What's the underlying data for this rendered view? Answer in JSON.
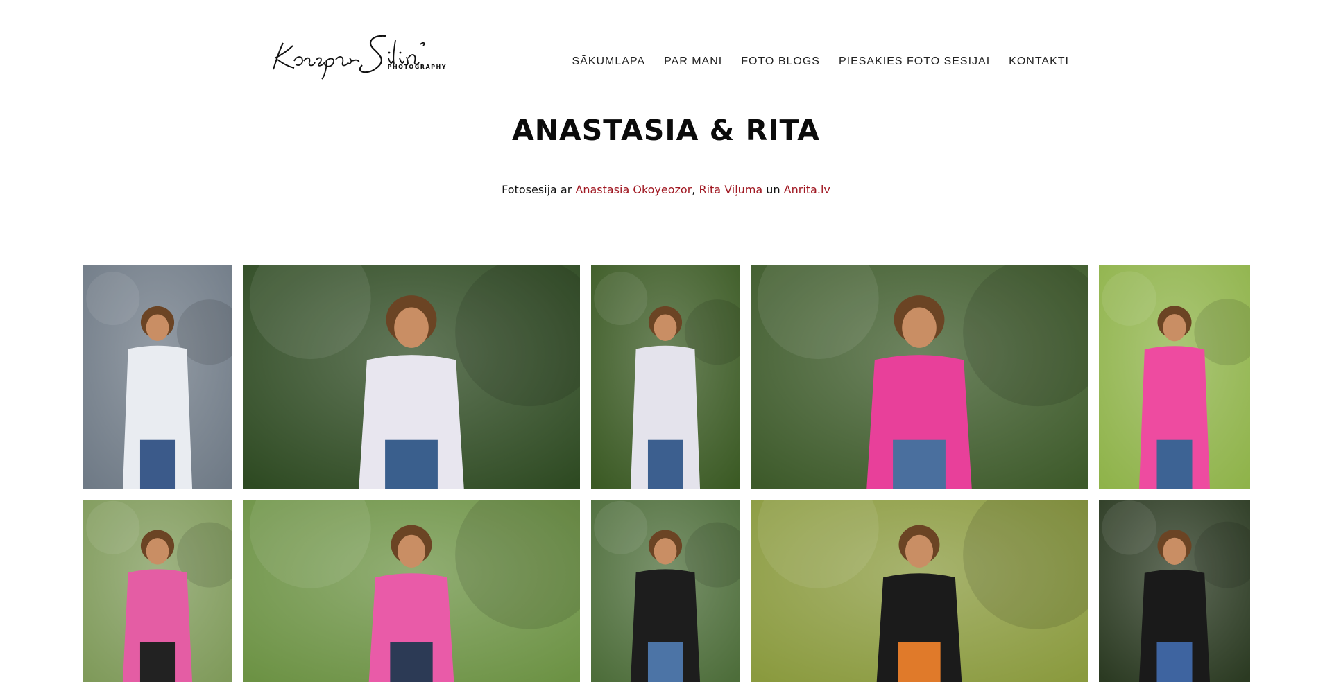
{
  "header": {
    "logo_name": "Kaspars Siliņš",
    "logo_tagline": "PHOTOGRAPHY",
    "nav": [
      {
        "label": "SĀKUMLAPA"
      },
      {
        "label": "PAR MANI"
      },
      {
        "label": "FOTO BLOGS"
      },
      {
        "label": "PIESAKIES FOTO SESIJAI"
      },
      {
        "label": "KONTAKTI"
      }
    ]
  },
  "post": {
    "title": "ANASTASIA & RITA",
    "intro_prefix": "Fotosesija ar ",
    "link1": "Anastasia Okoyeozor",
    "sep1": ", ",
    "link2": "Rita Viļuma",
    "sep2": " un ",
    "link3": "Anrita.lv"
  },
  "colors": {
    "accent_link": "#a01822",
    "text": "#111111",
    "divider": "#e6e6e6"
  },
  "gallery": [
    {
      "name": "photo-white-poncho-stone-wall",
      "bg": "#6f7a86",
      "fg": "#e9ecf1",
      "accent": "#3b5a8a"
    },
    {
      "name": "photo-white-poncho-dark-green",
      "bg": "#2e4a22",
      "fg": "#e8e6ef",
      "accent": "#3a5f8d"
    },
    {
      "name": "photo-white-poncho-side",
      "bg": "#3b5a24",
      "fg": "#e4e3ec",
      "accent": "#3c5f8f"
    },
    {
      "name": "photo-pink-top-log-bench",
      "bg": "#3d5a2a",
      "fg": "#e8409a",
      "accent": "#4a6f9e"
    },
    {
      "name": "photo-pink-top-sunny",
      "bg": "#8fb34a",
      "fg": "#ee4ba0",
      "accent": "#3d6394"
    },
    {
      "name": "photo-pink-scarf-lake",
      "bg": "#7f9a5a",
      "fg": "#e45da4",
      "accent": "#222222"
    },
    {
      "name": "photo-pink-scarf-back",
      "bg": "#6c9244",
      "fg": "#e95ba8",
      "accent": "#2c3a55"
    },
    {
      "name": "photo-black-top-sitting",
      "bg": "#4d6d3a",
      "fg": "#1d1d1d",
      "accent": "#4c74a6"
    },
    {
      "name": "photo-black-top-closeup",
      "bg": "#8a9a3e",
      "fg": "#1b1b1b",
      "accent": "#e07a2a"
    },
    {
      "name": "photo-black-top-park",
      "bg": "#2b3a22",
      "fg": "#1a1a1a",
      "accent": "#3e64a0"
    }
  ]
}
